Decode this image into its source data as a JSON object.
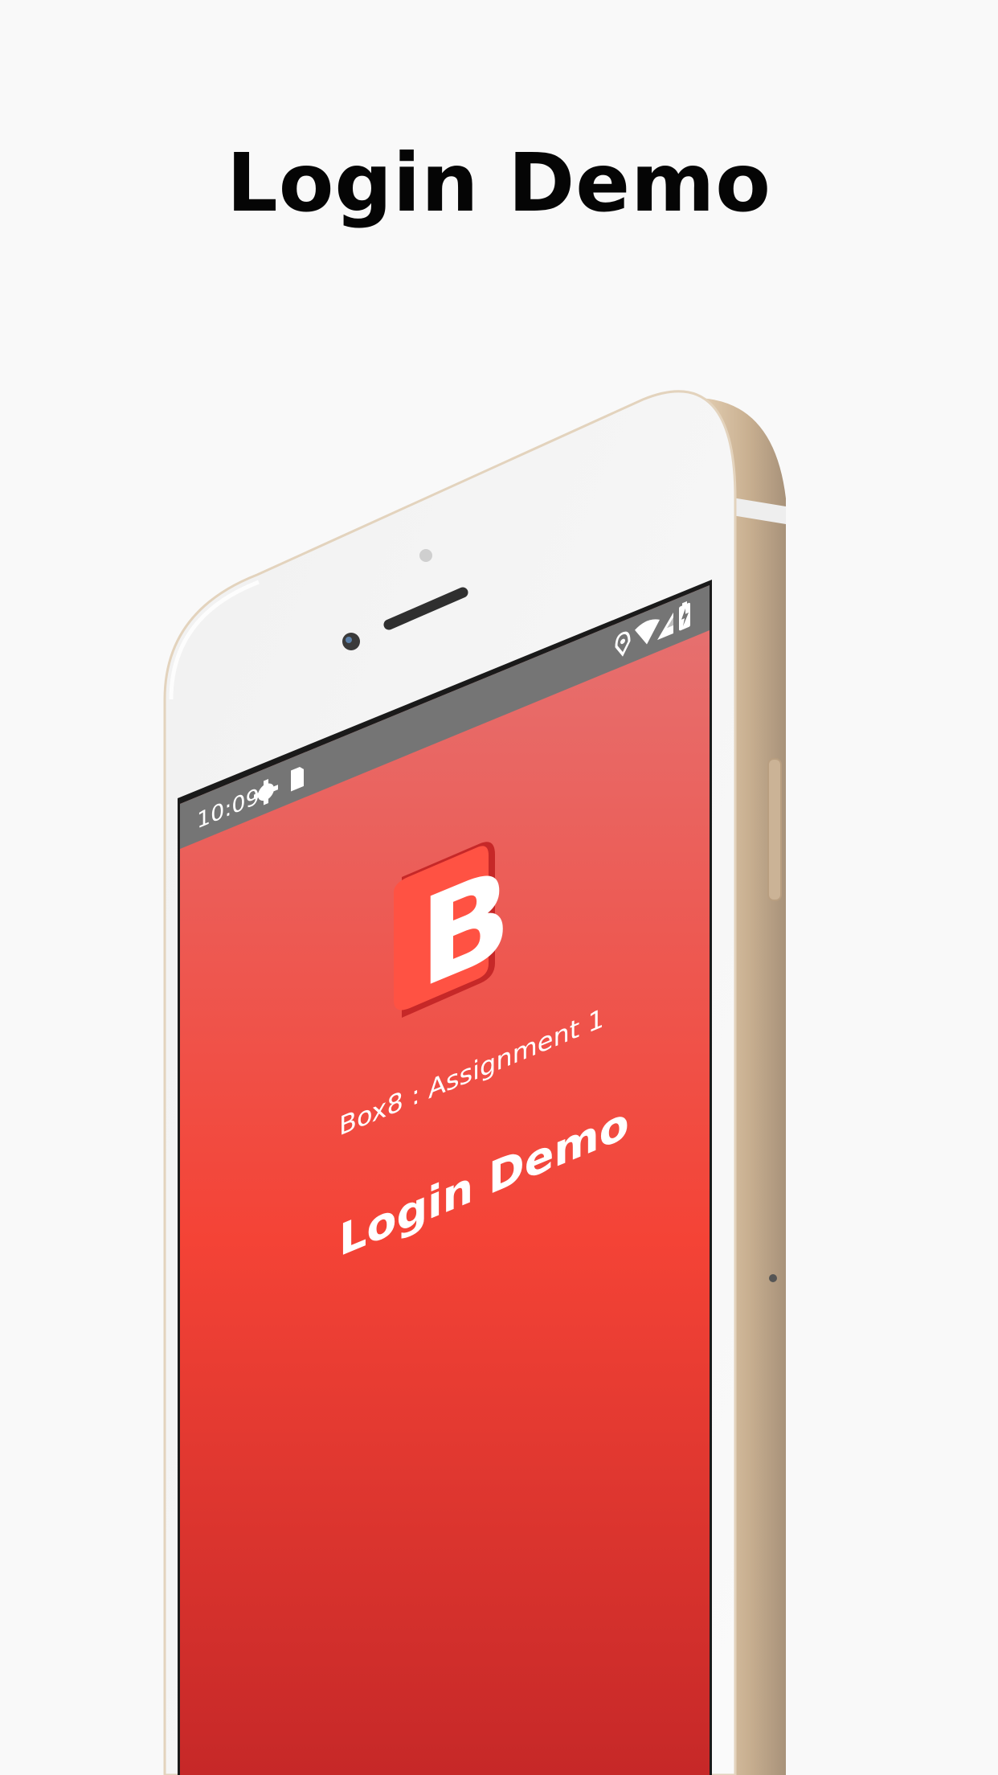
{
  "page": {
    "title": "Login Demo"
  },
  "status_bar": {
    "time": "10:09",
    "left_icons": [
      "gear-icon",
      "sd-card-icon"
    ],
    "right_icons": [
      "location-pin-icon",
      "wifi-icon",
      "cell-signal-icon",
      "battery-charging-icon"
    ]
  },
  "app": {
    "logo_letter": "B",
    "subtitle": "Box8 : Assignment 1",
    "title": "Login Demo"
  },
  "colors": {
    "background": "#f9f9f9",
    "status_bar": "#757575",
    "screen_gradient_top": "#e57373",
    "screen_gradient_mid": "#f44336",
    "screen_gradient_bottom": "#c62828",
    "logo_face": "#ff5243",
    "logo_side": "#c62828",
    "phone_gold": "#d9c2a5",
    "phone_front": "#f5f5f5"
  }
}
